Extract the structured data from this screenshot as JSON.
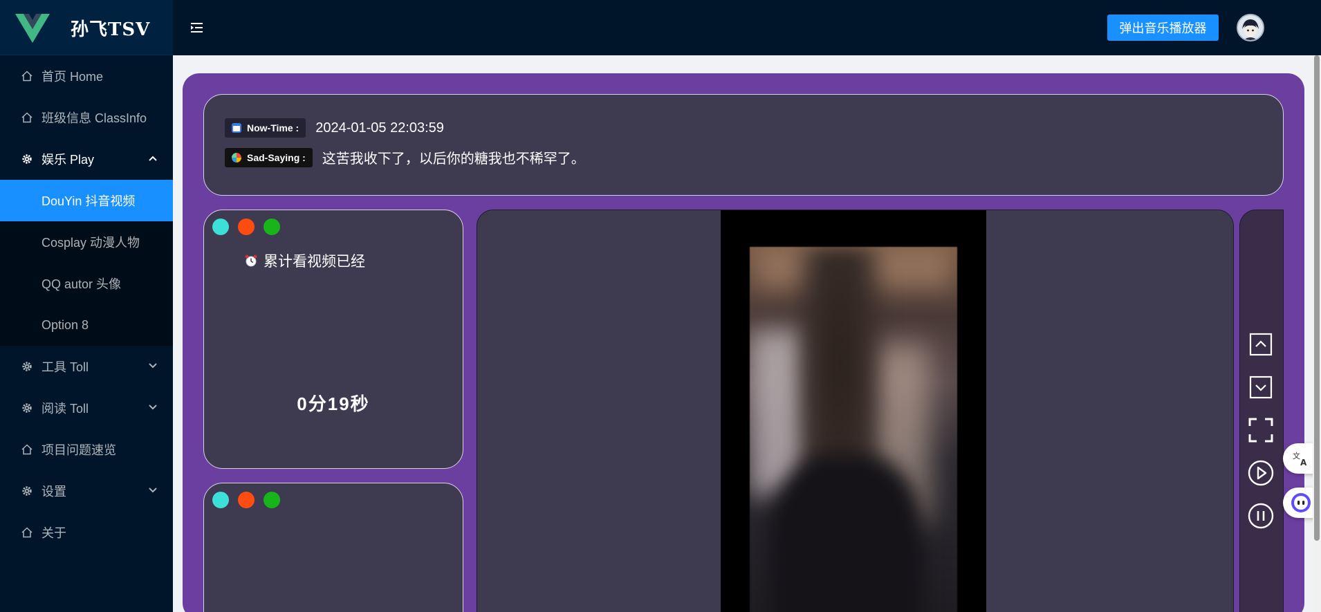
{
  "brand": {
    "title": "孙飞TSV",
    "logo_icon": "vue-logo"
  },
  "header": {
    "popup_music_button": "弹出音乐播放器",
    "avatar_icon": "user-avatar"
  },
  "sidebar": {
    "items": [
      {
        "label": "首页 Home",
        "icon": "home-icon"
      },
      {
        "label": "班级信息 ClassInfo",
        "icon": "home-icon"
      },
      {
        "label": "娱乐 Play",
        "icon": "gear-icon",
        "open": true,
        "children": [
          {
            "label": "DouYin 抖音视频",
            "active": true
          },
          {
            "label": "Cosplay 动漫人物"
          },
          {
            "label": "QQ autor 头像"
          },
          {
            "label": "Option 8"
          }
        ]
      },
      {
        "label": "工具 Toll",
        "icon": "gear-icon"
      },
      {
        "label": "阅读 Toll",
        "icon": "gear-icon"
      },
      {
        "label": "项目问题速览",
        "icon": "home-icon"
      },
      {
        "label": "设置",
        "icon": "gear-icon"
      },
      {
        "label": "关于",
        "icon": "home-icon"
      }
    ]
  },
  "info": {
    "now_time_label": "Now-Time :",
    "now_time_value": "2024-01-05 22:03:59",
    "sad_saying_label": "Sad-Saying :",
    "sad_saying_value": "这苦我收下了，以后你的糖我也不稀罕了。"
  },
  "stats": {
    "watch_title": "累计看视频已经",
    "watch_value": "0分19秒",
    "dot_colors": [
      "#3de0d8",
      "#ff4d12",
      "#17b51a"
    ]
  },
  "controls": [
    "arrow-up-icon",
    "arrow-down-icon",
    "fullscreen-icon",
    "play-icon",
    "pause-icon"
  ],
  "colors": {
    "accent": "#1890ff",
    "sidebar": "#001529",
    "panel": "#6b3fa0",
    "card": "#3e3a50"
  }
}
